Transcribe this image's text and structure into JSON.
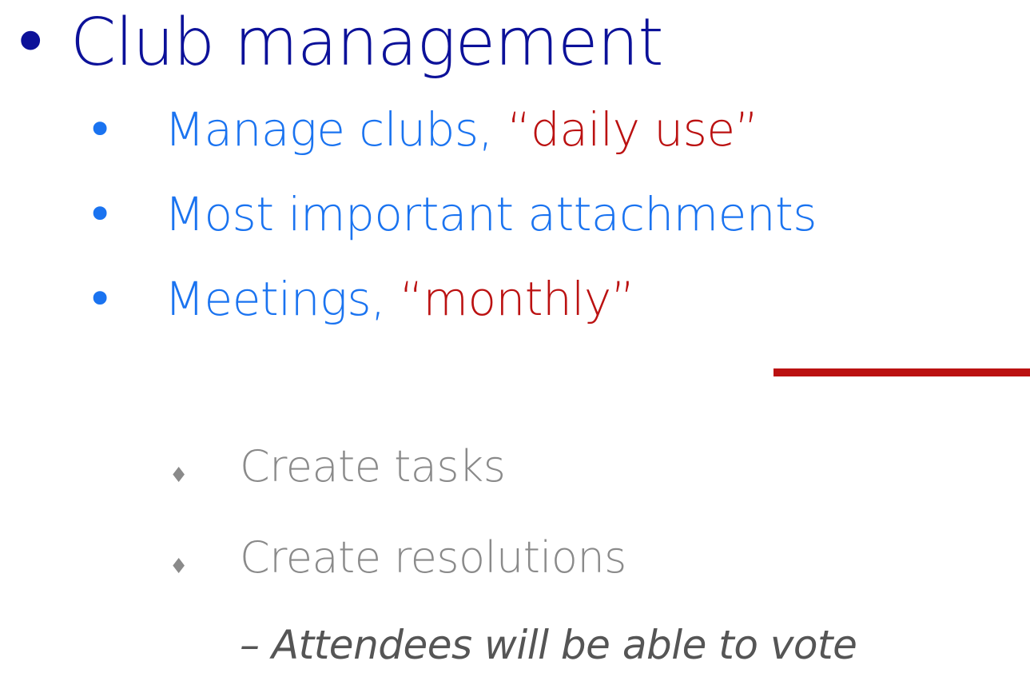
{
  "slide": {
    "level1": {
      "bullet": "•",
      "text": "Club management"
    },
    "level2": [
      {
        "bullet": "•",
        "text": "Manage clubs, ",
        "highlight": "“daily use”"
      },
      {
        "bullet": "•",
        "text": "Most important attachments",
        "highlight": ""
      },
      {
        "bullet": "•",
        "text": "Meetings, ",
        "highlight": "“monthly”"
      }
    ],
    "level3": [
      {
        "bullet": "♦",
        "text": "Create tasks"
      },
      {
        "bullet": "♦",
        "text": "Create resolutions"
      }
    ],
    "level4": {
      "text": "– Attendees will be able to vote"
    }
  },
  "colors": {
    "level1": "#0c1199",
    "level2": "#1a73f0",
    "highlight": "#bb1111",
    "level3": "#8a8a8a",
    "level4": "#555555"
  }
}
